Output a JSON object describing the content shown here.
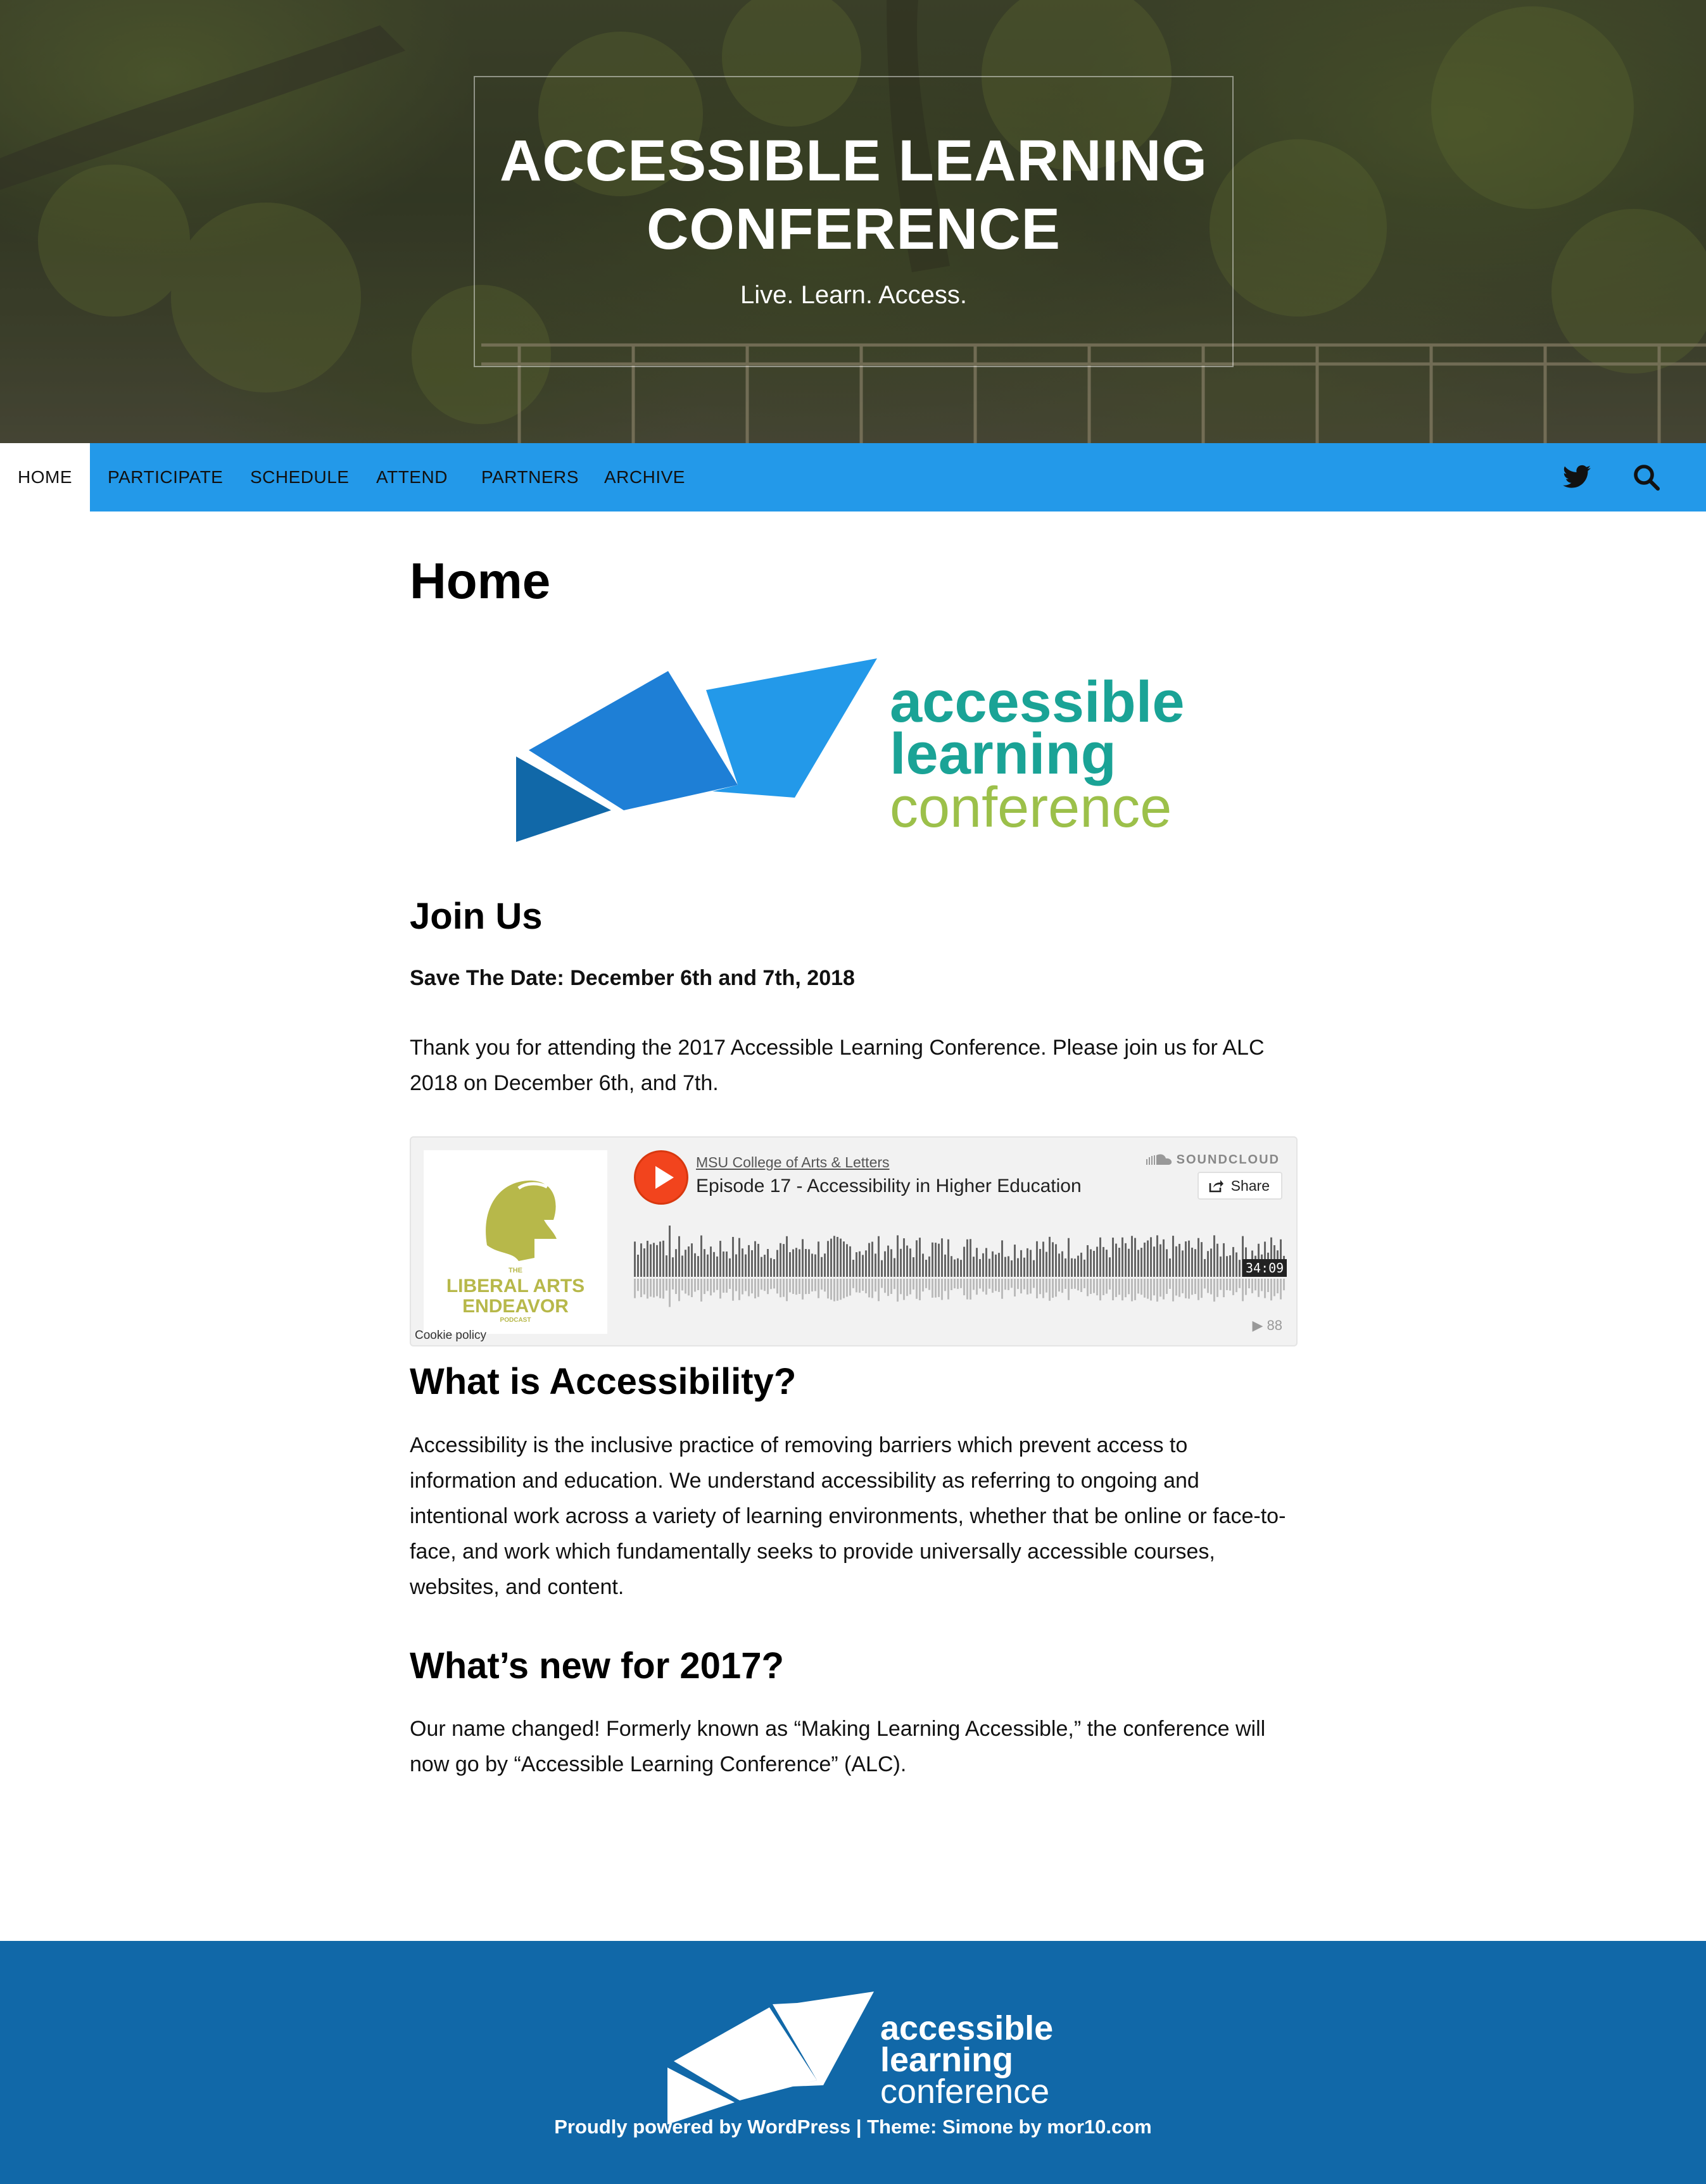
{
  "site": {
    "title": "ACCESSIBLE LEARNING CONFERENCE",
    "tagline": "Live. Learn. Access."
  },
  "nav": {
    "items": [
      {
        "label": "HOME",
        "active": true
      },
      {
        "label": "PARTICIPATE",
        "active": false
      },
      {
        "label": "SCHEDULE",
        "active": false
      },
      {
        "label": "ATTEND",
        "active": false
      },
      {
        "label": "PARTNERS",
        "active": false
      },
      {
        "label": "ARCHIVE",
        "active": false
      }
    ],
    "icons": [
      "twitter-icon",
      "search-icon"
    ]
  },
  "main": {
    "page_title": "Home",
    "logo": {
      "line1": "accessible",
      "line2": "learning",
      "line3": "conference",
      "colors": {
        "teal": "#1aa396",
        "green": "#9cc04a",
        "blue_dark": "#1168a8",
        "blue_mid": "#1e7fd6",
        "blue_light": "#2399e9"
      }
    },
    "join": {
      "heading": "Join Us",
      "save_date": "Save The Date: December 6th and 7th, 2018",
      "body": "Thank you for attending the 2017 Accessible Learning Conference. Please join us for ALC 2018 on December 6th, and 7th."
    },
    "soundcloud": {
      "user": "MSU College of Arts & Letters",
      "track": "Episode 17 - Accessibility in Higher Education",
      "brand": "SOUNDCLOUD",
      "share_label": "Share",
      "duration": "34:09",
      "plays": "88",
      "cookie_label": "Cookie policy",
      "art": {
        "small": "THE",
        "line1": "LIBERAL ARTS",
        "line2": "ENDEAVOR",
        "small2": "PODCAST",
        "color": "#b7b84a"
      },
      "accent": "#f2441d"
    },
    "accessibility": {
      "heading": "What is Accessibility?",
      "body": "Accessibility is the inclusive practice of removing barriers which prevent access to information and education. We understand accessibility as referring to ongoing and intentional work across a variety of learning environments, whether that be online or face-to-face, and work which fundamentally seeks to provide universally accessible courses, websites, and content."
    },
    "new2017": {
      "heading": "What’s new for 2017?",
      "body": "Our name changed! Formerly known as “Making Learning Accessible,” the conference will now go by “Accessible Learning Conference” (ALC)."
    }
  },
  "footer": {
    "logo": {
      "line1": "accessible",
      "line2": "learning",
      "line3": "conference"
    },
    "credit": "Proudly powered by WordPress | Theme: Simone by mor10.com",
    "bg": "#1168a8"
  }
}
